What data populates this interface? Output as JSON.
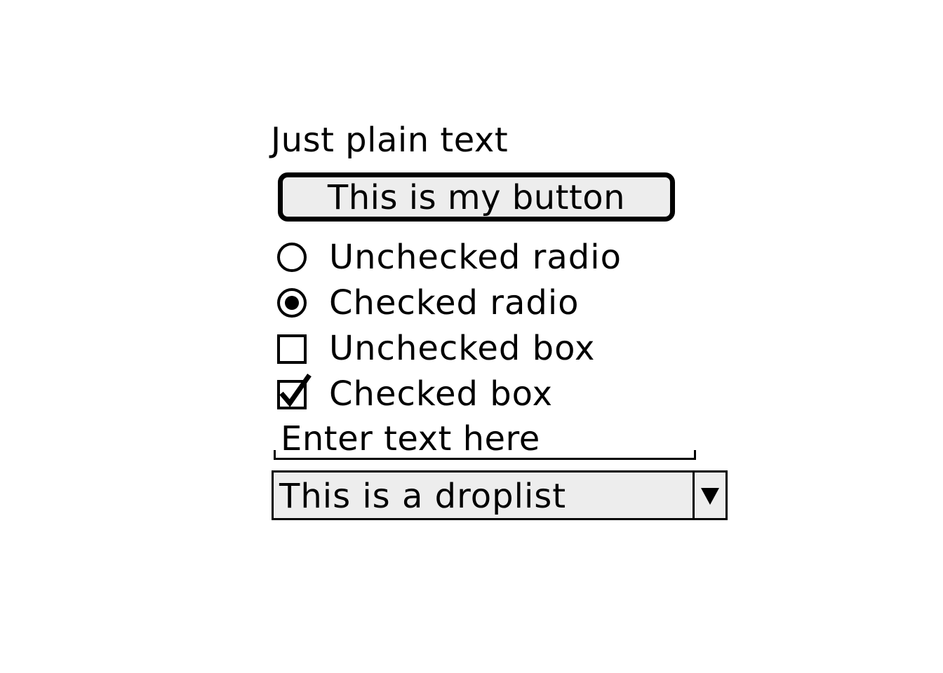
{
  "plain_text": "Just plain text",
  "button": {
    "label": "This is my button"
  },
  "options": {
    "unchecked_radio": {
      "label": "Unchecked radio",
      "checked": false
    },
    "checked_radio": {
      "label": "Checked radio",
      "checked": true
    },
    "unchecked_box": {
      "label": "Unchecked box",
      "checked": false
    },
    "checked_box": {
      "label": "Checked box",
      "checked": true
    }
  },
  "text_input": {
    "placeholder": "Enter text here"
  },
  "droplist": {
    "value": "This is a droplist",
    "icon": "triangle-down-icon"
  },
  "colors": {
    "control_fill": "#ededed",
    "stroke": "#000000",
    "background": "#ffffff"
  }
}
